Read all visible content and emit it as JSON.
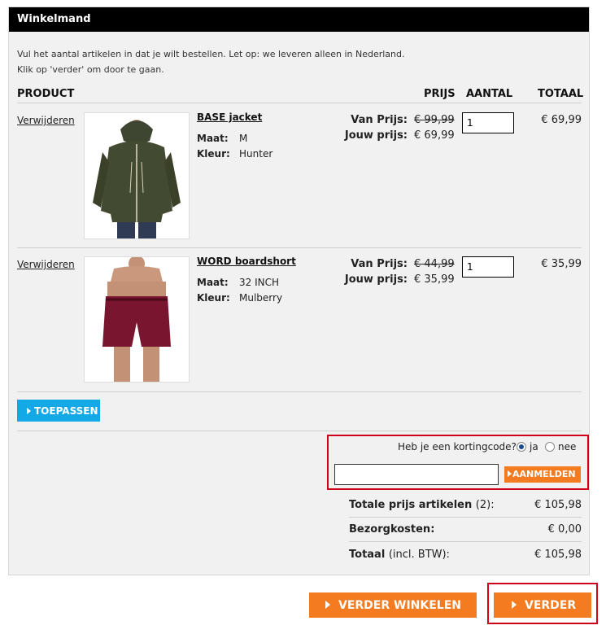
{
  "header": {
    "title": "Winkelmand"
  },
  "intro": {
    "line1": "Vul het aantal artikelen in dat je wilt bestellen. Let op: we leveren alleen in Nederland.",
    "line2": "Klik op 'verder' om door te gaan."
  },
  "table_header": {
    "product": "PRODUCT",
    "prijs": "PRIJS",
    "aantal": "AANTAL",
    "totaal": "TOTAAL"
  },
  "items": [
    {
      "remove_label": "Verwijderen",
      "name": "BASE jacket",
      "size_label": "Maat:",
      "size": "M",
      "color_label": "Kleur:",
      "color": "Hunter",
      "from_label": "Van Prijs:",
      "from_price": "€ 99,99",
      "your_label": "Jouw prijs:",
      "your_price": "€ 69,99",
      "quantity": "1",
      "total": "€ 69,99"
    },
    {
      "remove_label": "Verwijderen",
      "name": "WORD boardshort",
      "size_label": "Maat:",
      "size": "32 INCH",
      "color_label": "Kleur:",
      "color": "Mulberry",
      "from_label": "Van Prijs:",
      "from_price": "€ 44,99",
      "your_label": "Jouw prijs:",
      "your_price": "€ 35,99",
      "quantity": "1",
      "total": "€ 35,99"
    }
  ],
  "apply_button": "TOEPASSEN",
  "discount": {
    "question": "Heb je een kortingcode?",
    "yes": "ja",
    "no": "nee",
    "code_value": "",
    "submit": "AANMELDEN"
  },
  "summary": {
    "items_label": "Totale prijs artikelen",
    "items_count": "(2):",
    "items_value": "€ 105,98",
    "shipping_label": "Bezorgkosten:",
    "shipping_value": "€ 0,00",
    "total_label": "Totaal",
    "total_note": "(incl. BTW):",
    "total_value": "€ 105,98"
  },
  "buttons": {
    "continue_shopping": "VERDER WINKELEN",
    "next": "VERDER"
  },
  "colors": {
    "orange": "#f47b20",
    "blue": "#13a9e6",
    "highlight": "#d0021b"
  }
}
